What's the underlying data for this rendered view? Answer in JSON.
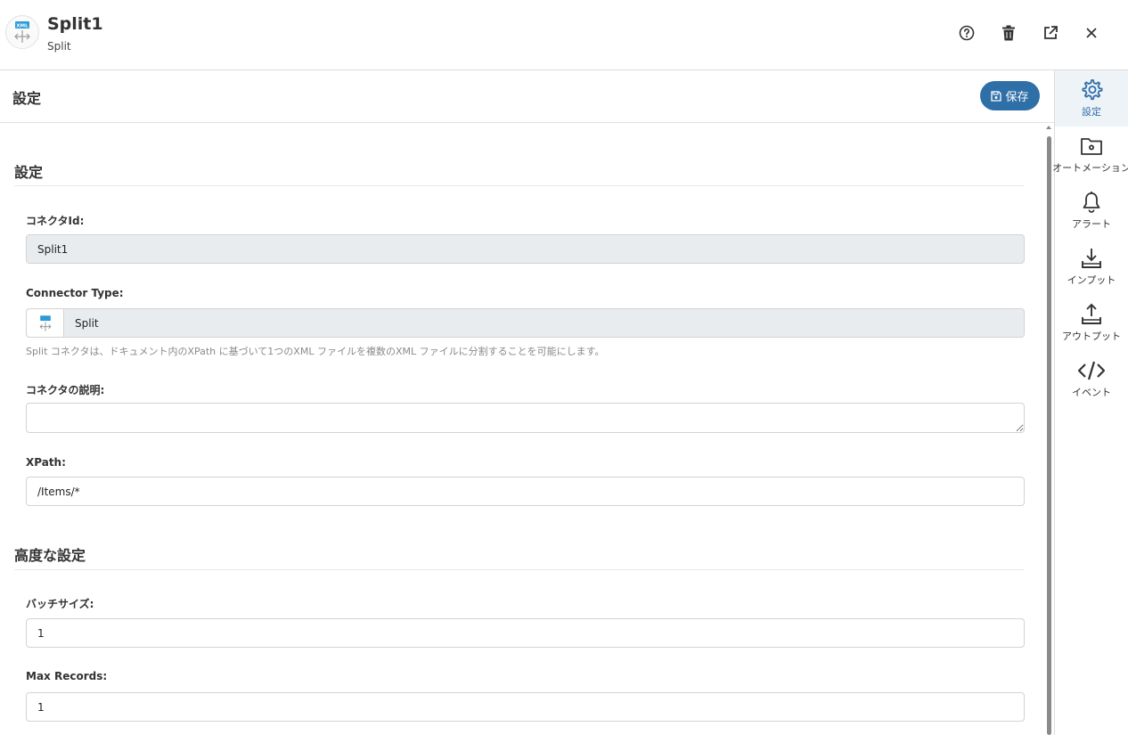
{
  "header": {
    "title": "Split1",
    "subtitle": "Split",
    "logo_text": "XML",
    "buttons": [
      "help-icon",
      "trash-icon",
      "external-link-icon",
      "close-icon"
    ]
  },
  "section": {
    "title": "設定",
    "save_label": "保存"
  },
  "settings": {
    "group_title": "設定",
    "connector_id_label": "コネクタId:",
    "connector_id_value": "Split1",
    "connector_type_label": "Connector Type:",
    "connector_type_value": "Split",
    "connector_type_help": "Split コネクタは、ドキュメント内のXPath に基づいて1つのXML ファイルを複数のXML ファイルに分割することを可能にします。",
    "description_label": "コネクタの説明:",
    "description_value": "",
    "xpath_label": "XPath:",
    "xpath_value": "/Items/*"
  },
  "advanced": {
    "group_title": "高度な設定",
    "batch_size_label": "バッチサイズ:",
    "batch_size_value": "1",
    "max_records_label": "Max Records:",
    "max_records_value": "1"
  },
  "sidebar": {
    "items": [
      {
        "label": "設定",
        "icon": "gear-icon",
        "active": true
      },
      {
        "label": "オートメーション",
        "icon": "folder-gear-icon",
        "active": false
      },
      {
        "label": "アラート",
        "icon": "bell-icon",
        "active": false
      },
      {
        "label": "インプット",
        "icon": "download-icon",
        "active": false
      },
      {
        "label": "アウトプット",
        "icon": "upload-icon",
        "active": false
      },
      {
        "label": "イベント",
        "icon": "code-icon",
        "active": false
      }
    ]
  },
  "colors": {
    "accent": "#2f6fa7",
    "readonly_bg": "#e9ecef",
    "active_bg": "#eef3f8"
  }
}
